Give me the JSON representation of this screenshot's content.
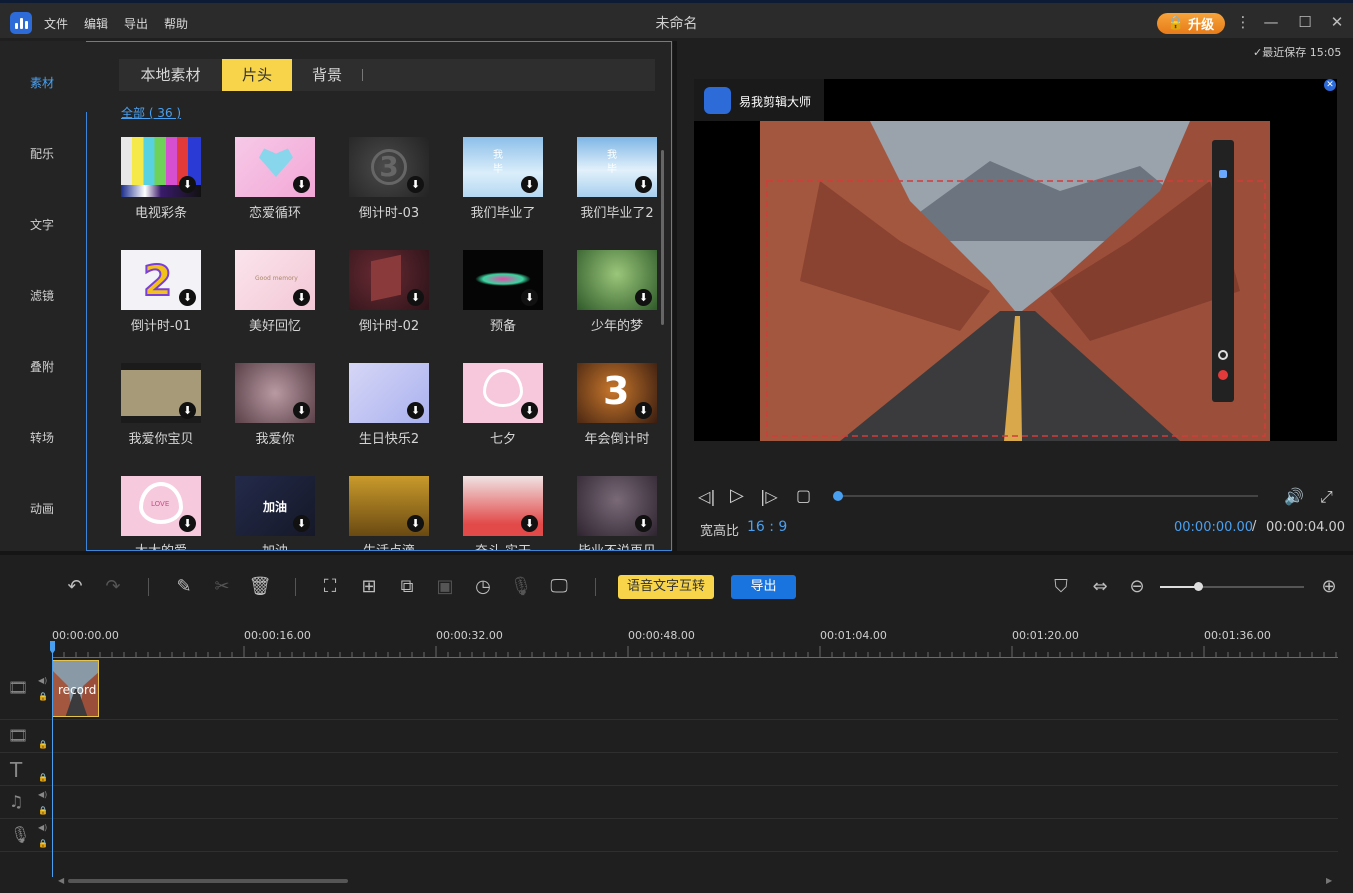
{
  "window": {
    "title": "未命名",
    "menu": [
      "文件",
      "编辑",
      "导出",
      "帮助"
    ],
    "upgrade_label": "升级",
    "icons": [
      "app-logo-icon",
      "lock-icon",
      "more-icon",
      "minimize-icon",
      "maximize-icon",
      "close-icon"
    ]
  },
  "sidebar": {
    "items": [
      {
        "label": "素材",
        "active": true
      },
      {
        "label": "配乐",
        "active": false
      },
      {
        "label": "文字",
        "active": false
      },
      {
        "label": "滤镜",
        "active": false
      },
      {
        "label": "叠附",
        "active": false
      },
      {
        "label": "转场",
        "active": false
      },
      {
        "label": "动画",
        "active": false
      }
    ]
  },
  "library": {
    "tabs": [
      {
        "label": "本地素材",
        "active": false
      },
      {
        "label": "片头",
        "active": true
      },
      {
        "label": "背景",
        "active": false
      }
    ],
    "filter_label": "全部 ( 36 )",
    "items": [
      "电视彩条",
      "恋爱循环",
      "倒计时-03",
      "我们毕业了",
      "我们毕业了2",
      "倒计时-01",
      "美好回忆",
      "倒计时-02",
      "预备",
      "少年的梦",
      "我爱你宝贝",
      "我爱你",
      "生日快乐2",
      "七夕",
      "年会倒计时",
      "大大的爱",
      "加油",
      "生活点滴",
      "奋斗 实干",
      "毕业不说再见"
    ],
    "thumb_text": {
      "countdown3": "3",
      "countdown2": "2",
      "love_text": "LOVE",
      "jiayou": "加油",
      "memory": "Good memory",
      "nianhui": "3",
      "biye": "我\n毕"
    },
    "download_icon": "download-icon"
  },
  "preview": {
    "last_saved": "最近保存 15:05",
    "banner_text": "易我剪辑大师",
    "aspect_label": "宽高比",
    "aspect_value": "16 : 9",
    "current_time": "00:00:00.00",
    "separator": "/",
    "total_time": "00:00:04.00",
    "progress": 0
  },
  "toolbar": {
    "speech_label": "语音文字互转",
    "export_label": "导出",
    "zoom_level": 0.26
  },
  "timeline": {
    "ruler_labels": [
      "00:00:00.00",
      "00:00:16.00",
      "00:00:32.00",
      "00:00:48.00",
      "00:01:04.00",
      "00:01:20.00",
      "00:01:36.00"
    ],
    "clip_label": "record"
  },
  "colors": {
    "accent": "#4aa0f0",
    "tab_active": "#f7d44a",
    "export": "#1a74e0",
    "upgrade": "#f08c2a"
  }
}
